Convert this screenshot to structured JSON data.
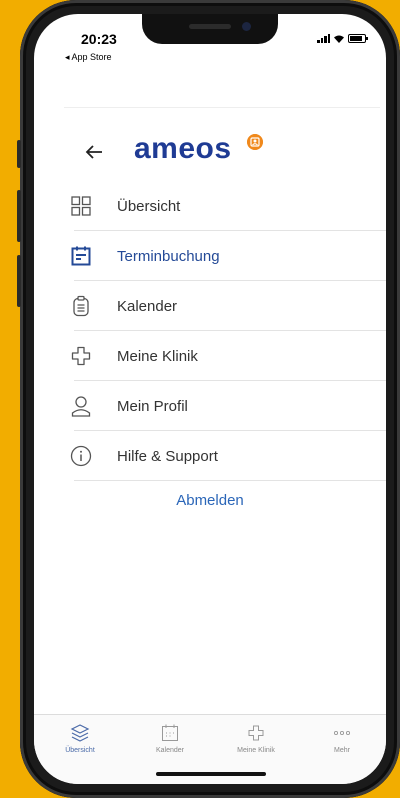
{
  "status_bar": {
    "time": "20:23",
    "back_app": "◂ App Store"
  },
  "brand": {
    "logo_text": "ameos"
  },
  "menu": {
    "items": [
      {
        "label": "Übersicht",
        "icon": "grid-icon",
        "active": false
      },
      {
        "label": "Terminbuchung",
        "icon": "calendar-booking-icon",
        "active": true
      },
      {
        "label": "Kalender",
        "icon": "clipboard-icon",
        "active": false
      },
      {
        "label": "Meine Klinik",
        "icon": "plus-cross-icon",
        "active": false
      },
      {
        "label": "Mein Profil",
        "icon": "user-icon",
        "active": false
      },
      {
        "label": "Hilfe & Support",
        "icon": "info-icon",
        "active": false
      }
    ],
    "logout_label": "Abmelden"
  },
  "tabbar": {
    "tabs": [
      {
        "label": "Übersicht",
        "icon": "layers-icon",
        "active": true
      },
      {
        "label": "Kalender",
        "icon": "calendar-icon",
        "active": false
      },
      {
        "label": "Meine Klinik",
        "icon": "plus-cross-icon",
        "active": false
      },
      {
        "label": "Mehr",
        "icon": "more-icon",
        "active": false
      }
    ]
  },
  "colors": {
    "background": "#f2ad00",
    "brand_blue": "#1f3b94",
    "active_blue": "#244a97",
    "link_blue": "#2b66b8",
    "badge_orange": "#f0891c"
  }
}
